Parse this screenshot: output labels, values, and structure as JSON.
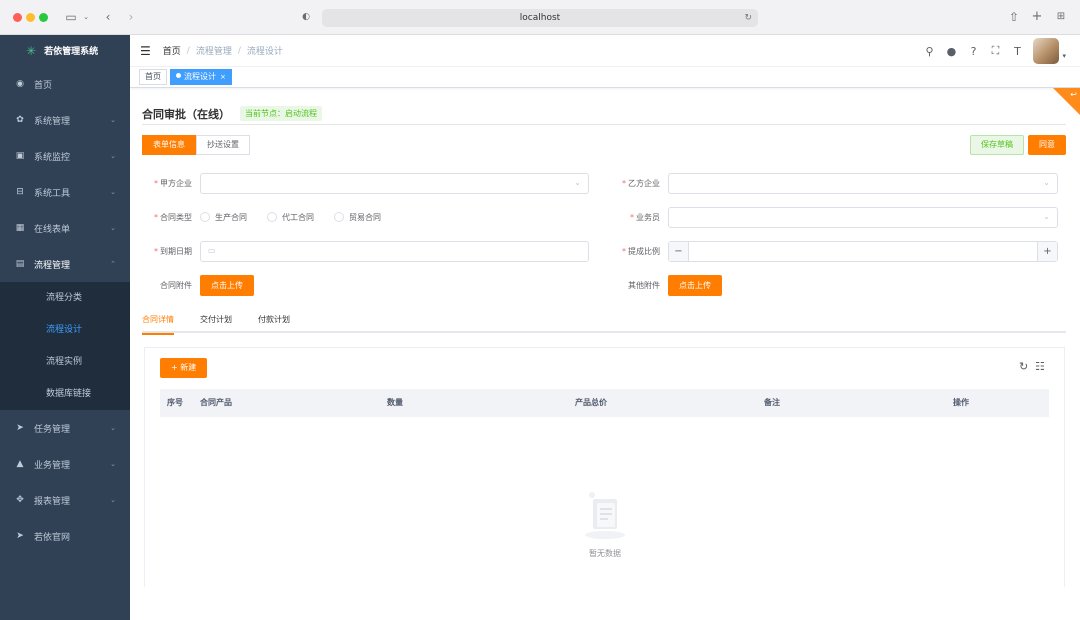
{
  "browser": {
    "url": "localhost"
  },
  "sidebar": {
    "logo_text": "若依管理系统",
    "items": [
      {
        "label": "首页",
        "icon": "dashboard-icon"
      },
      {
        "label": "系统管理",
        "icon": "gear-icon"
      },
      {
        "label": "系统监控",
        "icon": "monitor-icon"
      },
      {
        "label": "系统工具",
        "icon": "toolbox-icon"
      },
      {
        "label": "在线表单",
        "icon": "table-icon"
      },
      {
        "label": "流程管理",
        "icon": "document-icon"
      },
      {
        "label": "任务管理",
        "icon": "send-icon"
      },
      {
        "label": "业务管理",
        "icon": "lock-icon"
      },
      {
        "label": "报表管理",
        "icon": "move-icon"
      },
      {
        "label": "若依官网",
        "icon": "send-icon"
      }
    ],
    "sub_items": [
      "流程分类",
      "流程设计",
      "流程实例",
      "数据库链接"
    ],
    "active_sub": "流程设计"
  },
  "navbar": {
    "breadcrumb": [
      "首页",
      "流程管理",
      "流程设计"
    ]
  },
  "tags": {
    "home": "首页",
    "current": "流程设计"
  },
  "form": {
    "title": "合同审批（在线）",
    "node_badge": "当前节点：启动流程",
    "tabs": [
      "表单信息",
      "抄送设置"
    ],
    "save_draft": "保存草稿",
    "agree": "同意",
    "party_a_label": "甲方企业",
    "party_b_label": "乙方企业",
    "contract_type_label": "合同类型",
    "contract_types": [
      "生产合同",
      "代工合同",
      "贸易合同"
    ],
    "salesperson_label": "业务员",
    "due_date_label": "到期日期",
    "commission_label": "提成比例",
    "attachment_label": "合同附件",
    "other_attachment_label": "其他附件",
    "upload_label": "点击上传",
    "minus": "−",
    "plus": "+"
  },
  "detail_tabs": [
    "合同详情",
    "交付计划",
    "付款计划"
  ],
  "table": {
    "add_label": "+ 新建",
    "columns": [
      "序号",
      "合同产品",
      "数量",
      "产品总价",
      "备注",
      "操作"
    ],
    "empty_text": "暂无数据"
  },
  "colors": {
    "accent": "#ff7d00",
    "sidebar_bg": "#304156",
    "active_blue": "#409eff",
    "success_green": "#52c41a"
  }
}
